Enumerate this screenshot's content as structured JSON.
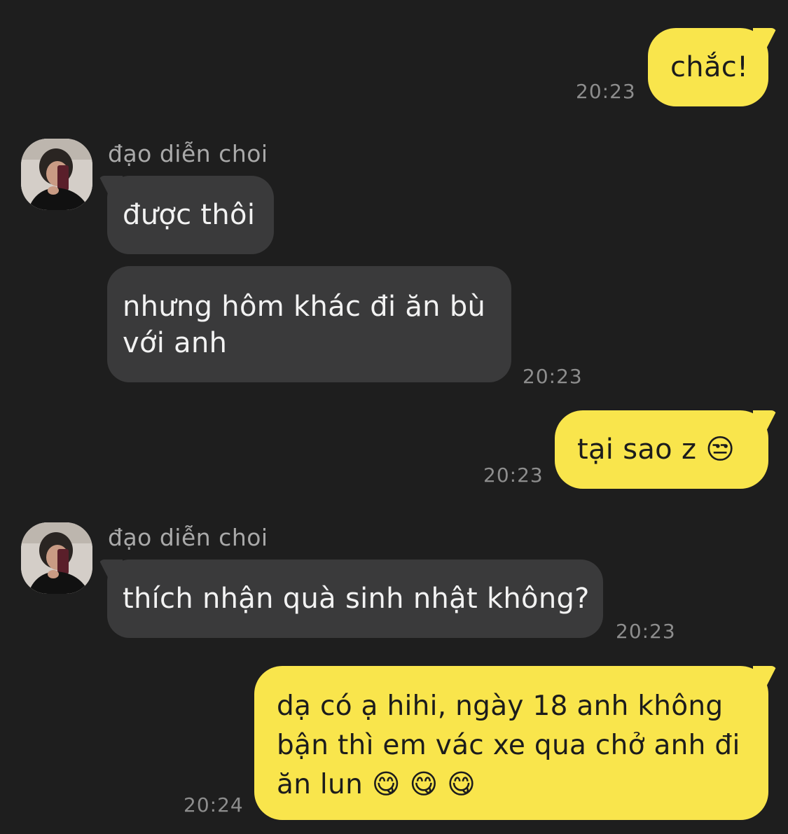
{
  "contact": {
    "name": "đạo diễn choi"
  },
  "messages": [
    {
      "direction": "out",
      "text": "chắc!",
      "time": "20:23"
    },
    {
      "direction": "in",
      "text": "được thôi"
    },
    {
      "direction": "in",
      "text": "nhưng hôm khác đi ăn bù với anh",
      "time": "20:23"
    },
    {
      "direction": "out",
      "text": "tại sao z 😒",
      "time": "20:23"
    },
    {
      "direction": "in",
      "text": "thích nhận quà sinh nhật không?",
      "time": "20:23"
    },
    {
      "direction": "out",
      "text": "dạ có ạ hihi, ngày 18 anh không bận thì em vác xe qua chở anh đi ăn lun 😋😋😋",
      "time": "20:24"
    }
  ],
  "display": {
    "m0": "chắc!",
    "m1": "được thôi",
    "m2_line1": "nhưng hôm khác đi ăn bù",
    "m2_line2": "với anh",
    "m3": "tại sao z",
    "m3_emoji": "😒",
    "m4": "thích nhận quà sinh nhật không?",
    "m5_line1": "dạ có ạ hihi, ngày 18 anh không",
    "m5_line2": "bận thì em vác xe qua chở anh đi",
    "m5_line3": "ăn lun",
    "m5_emoji": "😋 😋 😋"
  },
  "icons": {
    "avatar": "user-photo-avatar",
    "emoji_unamused": "unamused-face",
    "emoji_yum": "face-savoring-food"
  },
  "colors": {
    "background": "#1e1e1e",
    "outgoing_bubble": "#f9e54c",
    "incoming_bubble": "#3a3a3b",
    "timestamp": "#8d8d8d",
    "sender_name": "#a9a9a9"
  }
}
